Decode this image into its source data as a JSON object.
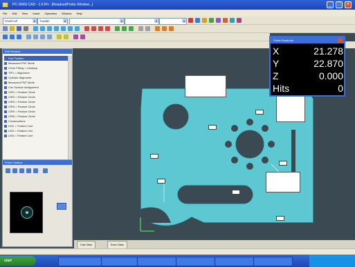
{
  "window": {
    "title": "PC-DMIS CAD - 1.0.Prt - [Readout/Probe Window...]",
    "controls": [
      "_",
      "□",
      "×"
    ]
  },
  "menu": {
    "items": [
      "File",
      "Edit",
      "View",
      "Insert",
      "Operation",
      "Window",
      "Help"
    ]
  },
  "toolbar": {
    "combos": [
      {
        "value": "STARTUP"
      },
      {
        "value": "T1A0B0"
      },
      {
        "value": ""
      },
      {
        "value": ""
      },
      {
        "value": ""
      }
    ]
  },
  "edit_window": {
    "title": "Edit Window",
    "items": [
      "Dim Position",
      "Measured PNT Mode",
      "Circle Fitting = Leastsqr",
      "TIP1 = Alignment",
      "Cylinder Alignment",
      "Measured PNT Mode",
      "Circ Surface Assignment",
      "CIR1 = Feature Circle",
      "CIR2 = Feature Circle",
      "CIR3 = Feature Circle",
      "CIR4 = Feature Circle",
      "CIR5 = Feature Circle",
      "CIR6 = Feature Circle",
      "Constructions",
      "LIN1 = Feature Line",
      "LIN2 = Feature Line",
      "LIN3 = Feature Line"
    ]
  },
  "probe_pane": {
    "title": "Probe Toolbox"
  },
  "readout": {
    "title": "Probe Readouts",
    "rows": [
      {
        "label": "X",
        "value": "21.278"
      },
      {
        "label": "Y",
        "value": "22.870"
      },
      {
        "label": "Z",
        "value": "0.000"
      },
      {
        "label": "Hits",
        "value": "0"
      }
    ]
  },
  "tabs": [
    "Cad View",
    "Exec View"
  ],
  "statusbar": {
    "text": ""
  },
  "taskbar": {
    "start": "start",
    "tasks": [
      "",
      "",
      "",
      "",
      "",
      ""
    ],
    "clock": ""
  }
}
